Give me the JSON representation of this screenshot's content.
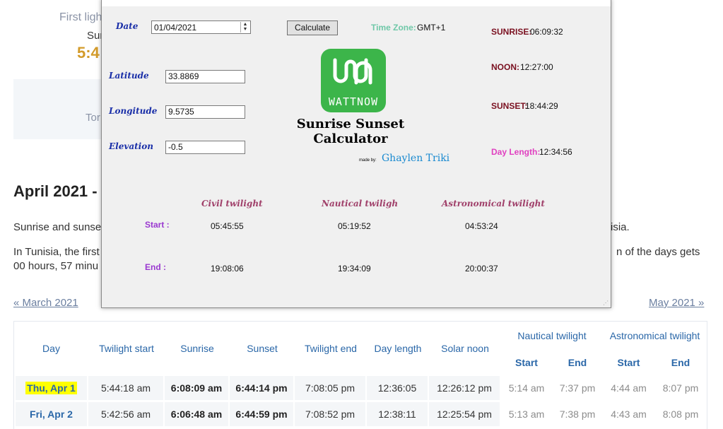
{
  "background": {
    "first_light": "First ligh",
    "sun_label": "Sur",
    "big_time": "5:4",
    "tomorrow": "Tor",
    "month_title": "April 2021 -",
    "para1_start": "Sunrise and sunse",
    "para1_end": "isia.",
    "para2_start": "In Tunisia, the first",
    "para2_end": "n of the days gets",
    "para3_start": "00 hours, 57 minu",
    "prev_month": "« March 2021",
    "next_month": "May 2021 »"
  },
  "table": {
    "headers": {
      "day": "Day",
      "twilight_start": "Twilight start",
      "sunrise": "Sunrise",
      "sunset": "Sunset",
      "twilight_end": "Twilight end",
      "day_length": "Day length",
      "solar_noon": "Solar noon",
      "nautical": "Nautical twilight",
      "astronomical": "Astronomical twilight",
      "start": "Start",
      "end": "End"
    },
    "rows": [
      {
        "day": "Thu, Apr 1",
        "tw_start": "5:44:18 am",
        "sunrise": "6:08:09 am",
        "sunset": "6:44:14 pm",
        "tw_end": "7:08:05 pm",
        "length": "12:36:05",
        "noon": "12:26:12 pm",
        "naut_start": "5:14 am",
        "naut_end": "7:37 pm",
        "astro_start": "4:44 am",
        "astro_end": "8:07 pm"
      },
      {
        "day": "Fri, Apr 2",
        "tw_start": "5:42:56 am",
        "sunrise": "6:06:48 am",
        "sunset": "6:44:59 pm",
        "tw_end": "7:08:52 pm",
        "length": "12:38:11",
        "noon": "12:25:54 pm",
        "naut_start": "5:13 am",
        "naut_end": "7:38 pm",
        "astro_start": "4:43 am",
        "astro_end": "8:08 pm"
      }
    ]
  },
  "app": {
    "labels": {
      "date": "Date",
      "latitude": "Latitude",
      "longitude": "Longitude",
      "elevation": "Elevation"
    },
    "inputs": {
      "date": "01/04/2021",
      "latitude": "33.8869",
      "longitude": "9.5735",
      "elevation": "-0.5"
    },
    "calculate_label": "Calculate",
    "timezone_label": "Time Zone:",
    "timezone_value": "GMT+1",
    "results": {
      "sunrise_label": "SUNRISE:",
      "sunrise_value": "06:09:32",
      "noon_label": "NOON:",
      "noon_value": "12:27:00",
      "sunset_label": "SUNSET:",
      "sunset_value": "18:44:29",
      "daylength_label": "Day Length:",
      "daylength_value": "12:34:56"
    },
    "logo_text": "WATTNOW",
    "title_line1": "Sunrise Sunset",
    "title_line2": "Calculator",
    "made_by": "made by:",
    "author": "Ghaylen Triki",
    "twilight": {
      "civil": "Civil twilight",
      "nautical": "Nautical twiligh",
      "astronomical": "Astronomical twilight",
      "start_label": "Start :",
      "end_label": "End :",
      "civil_start": "05:45:55",
      "nautical_start": "05:19:52",
      "astro_start": "04:53:24",
      "civil_end": "19:08:06",
      "nautical_end": "19:34:09",
      "astro_end": "20:00:37"
    }
  },
  "colors": {
    "logo_green": "#3cb54a",
    "label_blue": "#1a2fa8",
    "result_red": "#7a1020",
    "daylength_pink": "#e040c0",
    "timezone_teal": "#6fc8a8",
    "twilight_header": "#a0406a",
    "twilight_row": "#9a38d0",
    "table_header_blue": "#2a67a8",
    "highlight_yellow": "#ffff00"
  }
}
